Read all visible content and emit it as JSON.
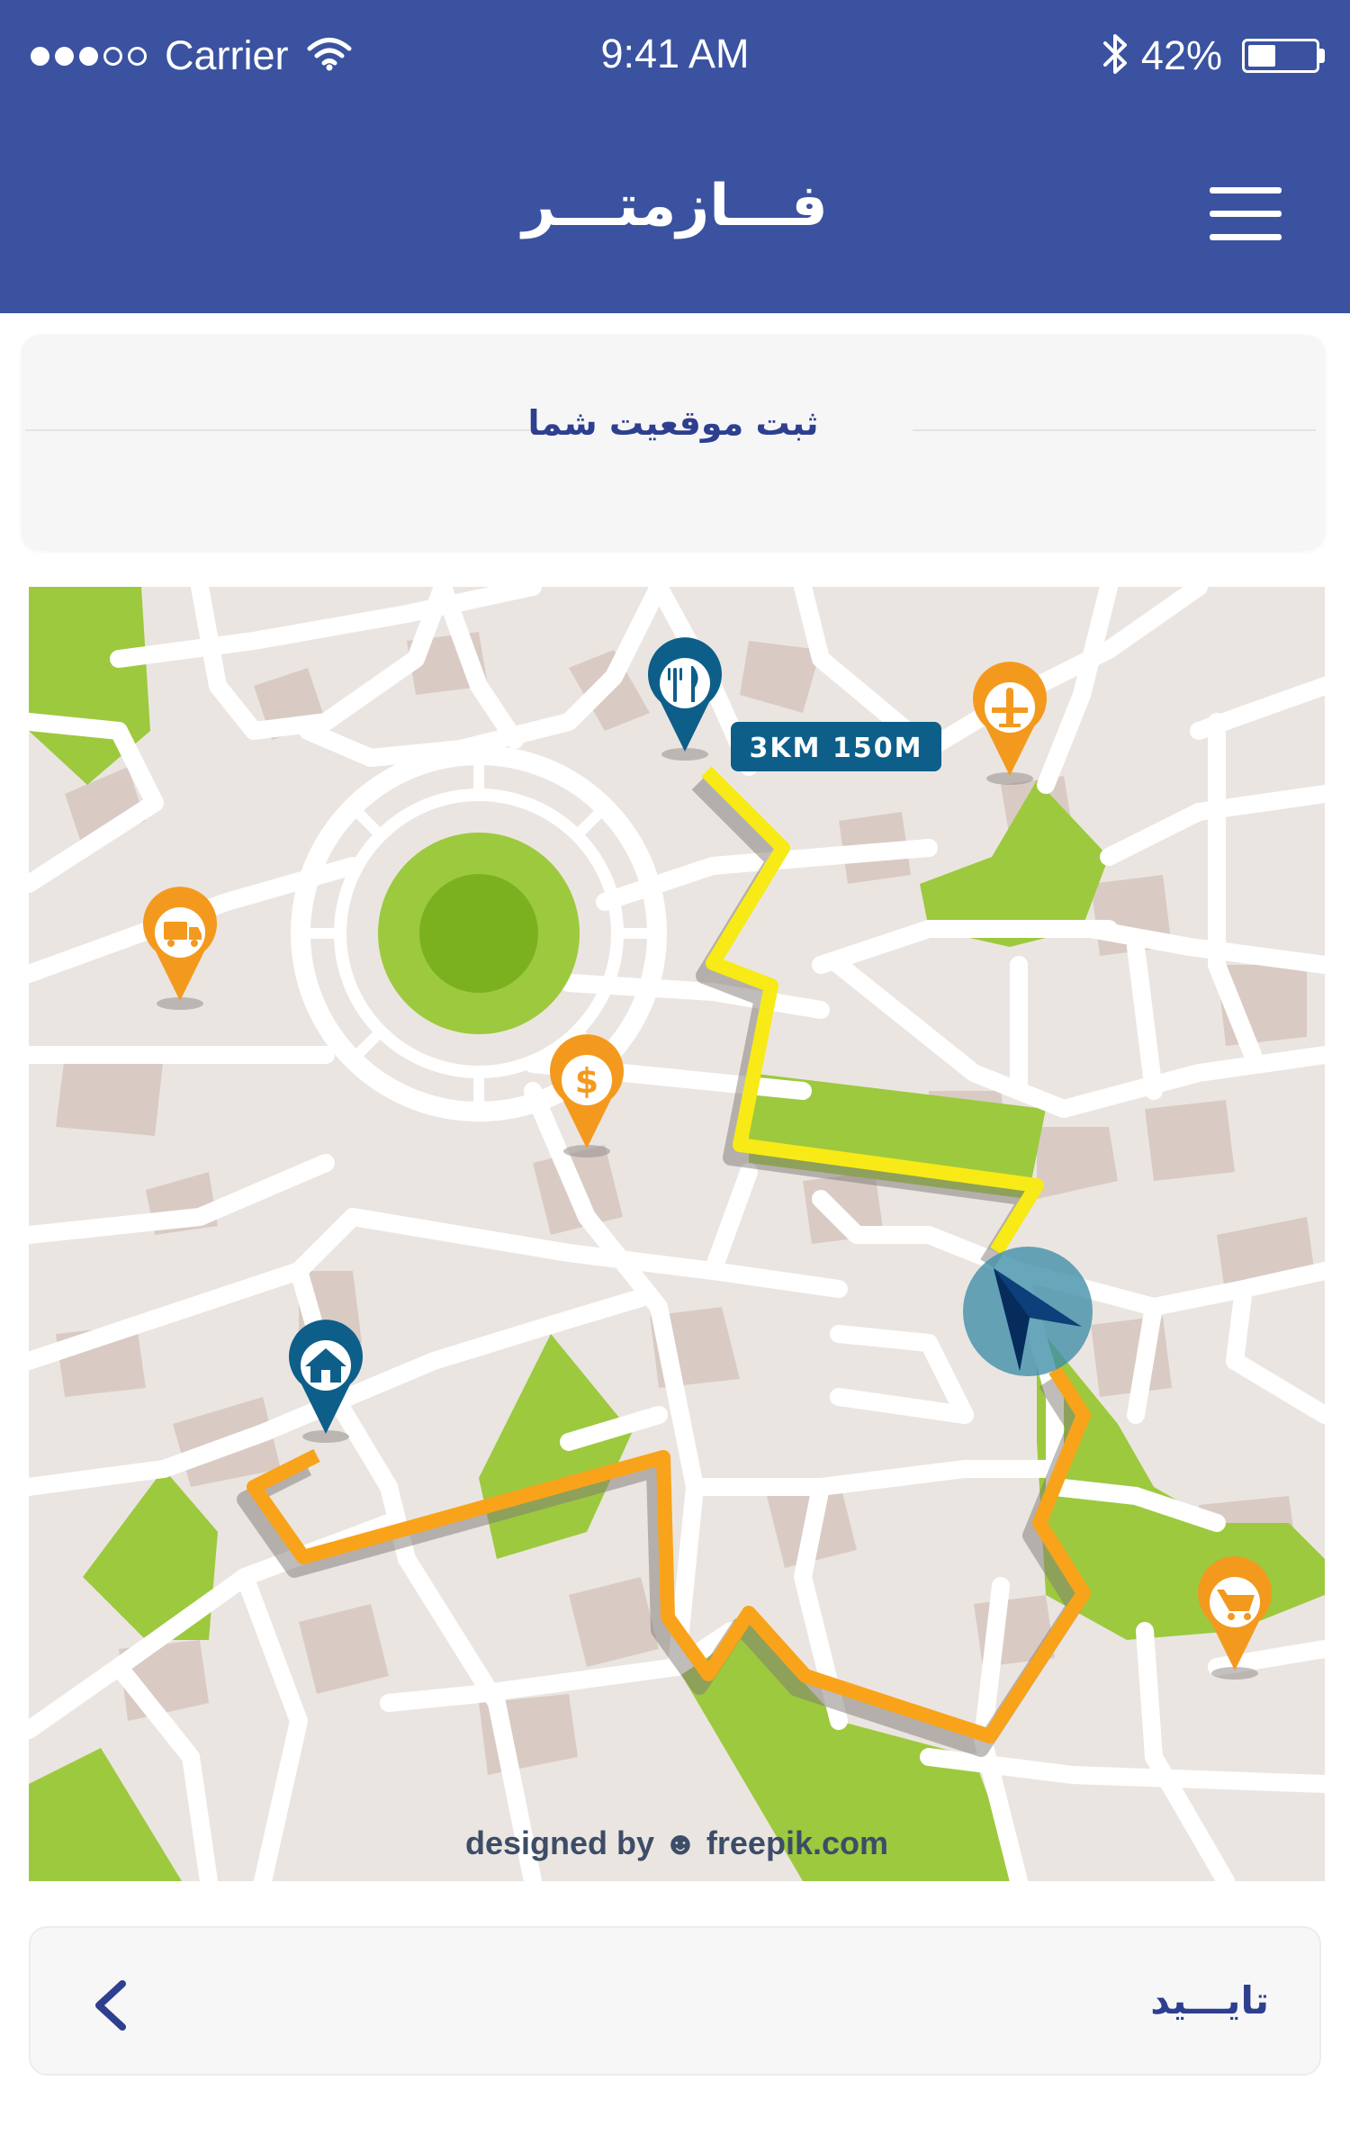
{
  "status_bar": {
    "carrier": "Carrier",
    "time": "9:41 AM",
    "battery_percent": "42%",
    "battery_level": 0.42,
    "signal_bars_filled": 3,
    "signal_bars_total": 5
  },
  "header": {
    "title": "فـــازمتـــر",
    "menu_icon": "hamburger-icon",
    "background_color": "#3a52a0"
  },
  "location_card": {
    "title": "ثبت موقعیت شما"
  },
  "map": {
    "distance_label": "3KM 150M",
    "credit": "designed by ☻ freepik.com",
    "pins": [
      {
        "name": "restaurant-pin",
        "icon": "fork-knife-icon",
        "color": "#0d5f8a"
      },
      {
        "name": "airport-pin",
        "icon": "airplane-icon",
        "color": "#f39a1e"
      },
      {
        "name": "delivery-pin",
        "icon": "truck-icon",
        "color": "#f39a1e"
      },
      {
        "name": "bank-pin",
        "icon": "dollar-icon",
        "color": "#f39a1e"
      },
      {
        "name": "home-pin",
        "icon": "house-icon",
        "color": "#0d5f8a"
      },
      {
        "name": "shopping-pin",
        "icon": "cart-icon",
        "color": "#f39a1e"
      }
    ],
    "colors": {
      "road": "#ffffff",
      "block": "#ebe5e1",
      "building": "#d9cbc4",
      "park": "#9dc93e",
      "route_yellow": "#f8ea16",
      "route_orange": "#f9a31a",
      "marker": "#0d5f8a"
    }
  },
  "confirm": {
    "label": "تایـــید",
    "back_icon": "chevron-left-icon"
  }
}
